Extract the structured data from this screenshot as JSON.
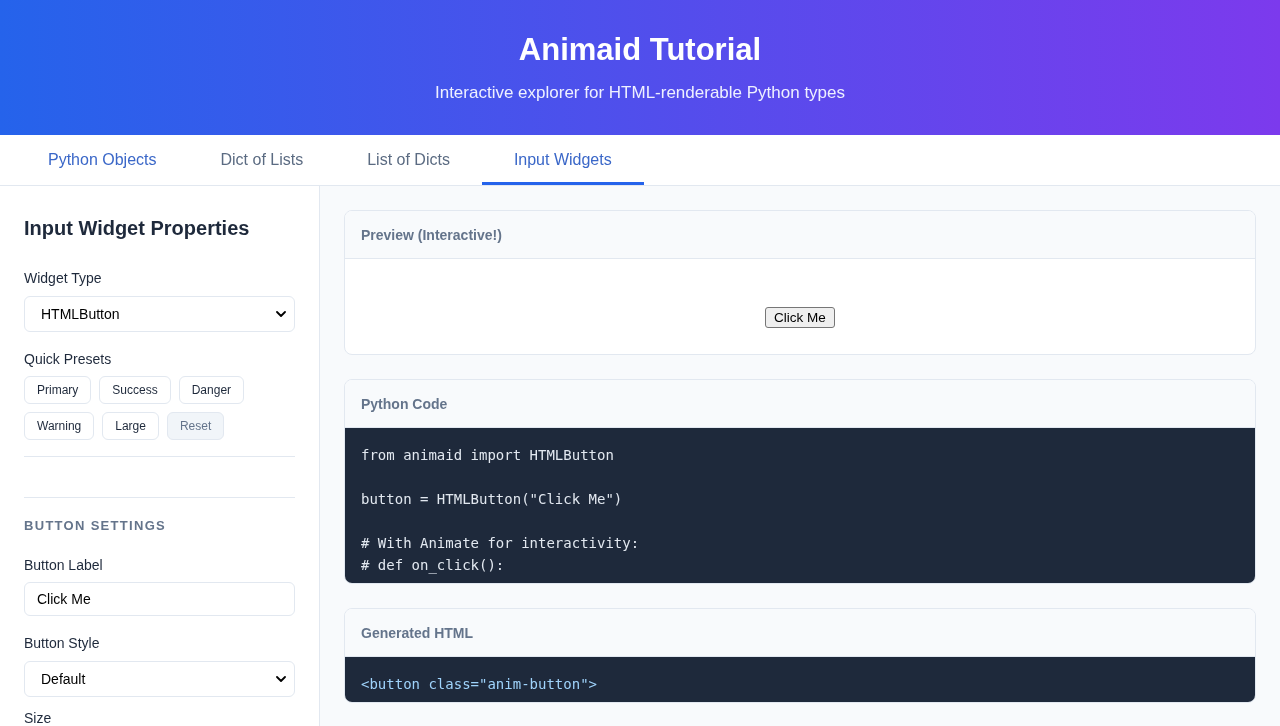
{
  "header": {
    "title": "Animaid Tutorial",
    "subtitle": "Interactive explorer for HTML-renderable Python types"
  },
  "tabs": [
    {
      "label": "Python Objects",
      "selected": false,
      "hovered": true
    },
    {
      "label": "Dict of Lists",
      "selected": false,
      "hovered": false
    },
    {
      "label": "List of Dicts",
      "selected": false,
      "hovered": false
    },
    {
      "label": "Input Widgets",
      "selected": true,
      "hovered": false
    }
  ],
  "sidebar": {
    "title": "Input Widget Properties",
    "widget_type": {
      "label": "Widget Type",
      "value": "HTMLButton"
    },
    "quick_presets": {
      "label": "Quick Presets",
      "presets": [
        {
          "label": "Primary",
          "kind": "preset"
        },
        {
          "label": "Success",
          "kind": "preset"
        },
        {
          "label": "Danger",
          "kind": "preset"
        },
        {
          "label": "Warning",
          "kind": "preset"
        },
        {
          "label": "Large",
          "kind": "preset"
        },
        {
          "label": "Reset",
          "kind": "reset"
        }
      ]
    },
    "section_title": "BUTTON SETTINGS",
    "fields": [
      {
        "kind": "text",
        "label": "Button Label",
        "value": "Click Me"
      },
      {
        "kind": "select",
        "label": "Button Style",
        "value": "Default"
      },
      {
        "kind": "label",
        "label": "Size"
      }
    ]
  },
  "panels": [
    {
      "kind": "preview",
      "title": "Preview (Interactive!)",
      "button_label": "Click Me"
    },
    {
      "kind": "python",
      "title": "Python Code",
      "code": "from animaid import HTMLButton\n\nbutton = HTMLButton(\"Click Me\")\n\n# With Animate for interactivity:\n# def on_click():"
    },
    {
      "kind": "html",
      "title": "Generated HTML",
      "code": "<button class=\"anim-button\">"
    }
  ]
}
